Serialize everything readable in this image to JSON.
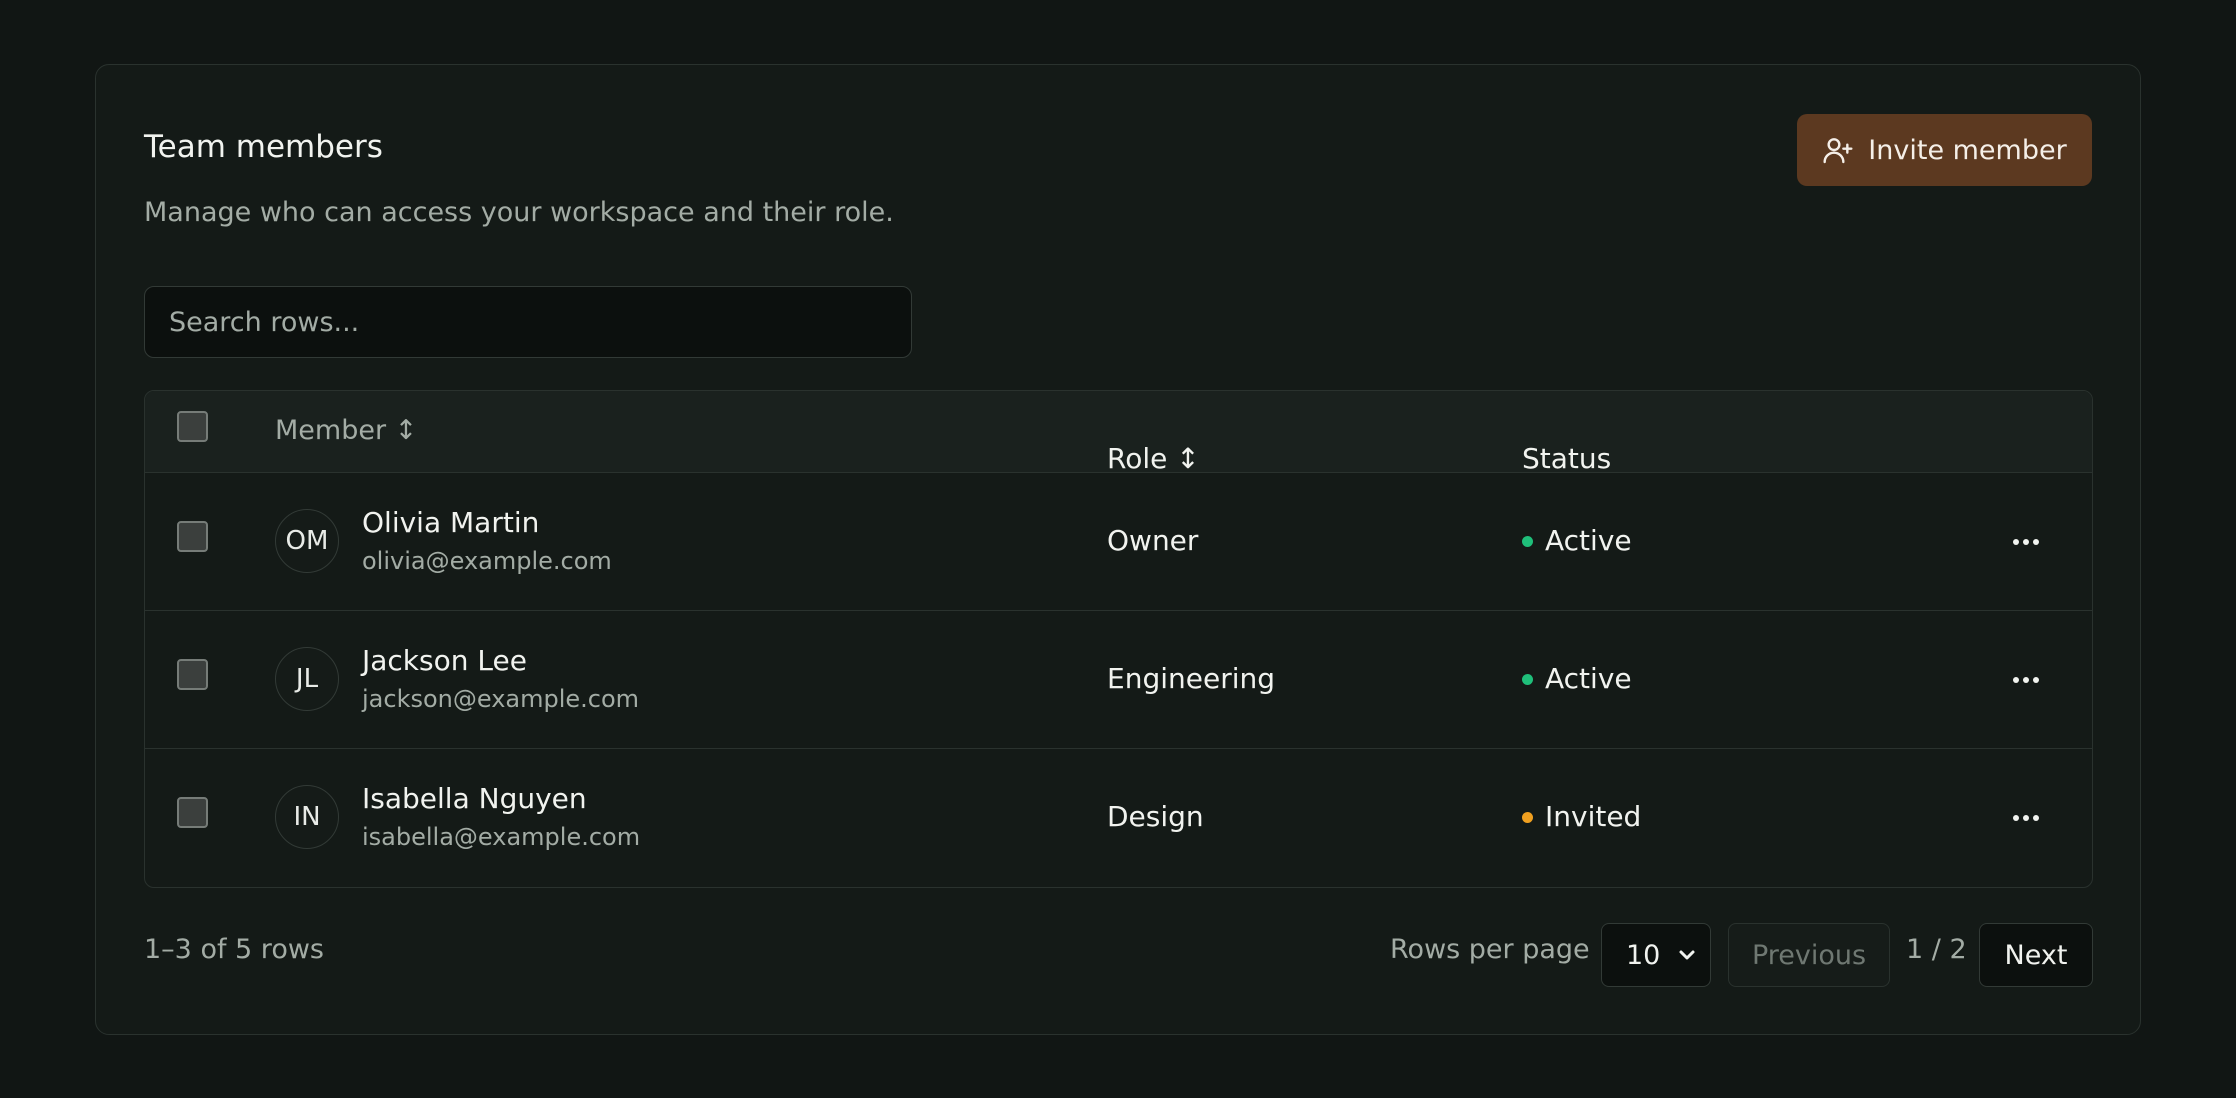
{
  "card": {
    "title": "Team members",
    "subtitle": "Manage who can access your workspace and their role.",
    "invite_label": "Invite member"
  },
  "search": {
    "placeholder": "Search rows..."
  },
  "table": {
    "headers": {
      "member": "Member ↕",
      "role": "Role ↕",
      "status": "Status"
    },
    "rows": [
      {
        "initials": "OM",
        "name": "Olivia Martin",
        "email": "olivia@example.com",
        "role": "Owner",
        "status": "Active",
        "status_color": "#1fbf7a"
      },
      {
        "initials": "JL",
        "name": "Jackson Lee",
        "email": "jackson@example.com",
        "role": "Engineering",
        "status": "Active",
        "status_color": "#1fbf7a"
      },
      {
        "initials": "IN",
        "name": "Isabella Nguyen",
        "email": "isabella@example.com",
        "role": "Design",
        "status": "Invited",
        "status_color": "#f0a020"
      }
    ]
  },
  "footer": {
    "row_count": "1–3 of 5 rows",
    "rows_per_page_label": "Rows per page",
    "rows_per_page_value": "10",
    "previous_label": "Previous",
    "page_indicator": "1 / 2",
    "next_label": "Next"
  },
  "colors": {
    "background": "#111614",
    "card": "#141a17",
    "accent_button": "#5c3920",
    "active": "#1fbf7a",
    "invited": "#f0a020"
  },
  "icons": {
    "invite": "user-plus-icon",
    "more": "more-horizontal-icon",
    "select": "chevron-down-icon"
  }
}
